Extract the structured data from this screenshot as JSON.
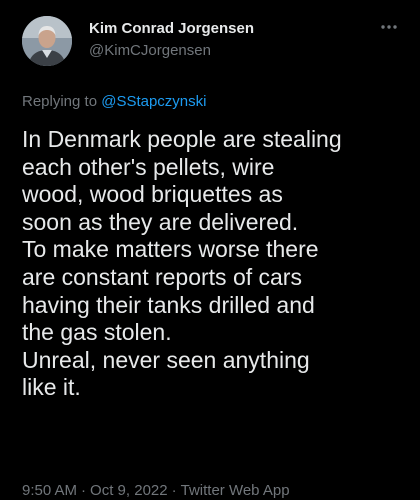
{
  "author": {
    "name": "Kim Conrad Jorgensen",
    "handle": "@KimCJorgensen"
  },
  "reply": {
    "prefix": "Replying to",
    "target": "@SStapczynski"
  },
  "tweet": {
    "lines": [
      "In Denmark people are stealing",
      "each other's pellets, wire",
      "wood, wood briquettes as",
      "soon as they are delivered.",
      "To make matters worse there",
      "are constant reports of cars",
      "having their tanks drilled and",
      "the gas stolen.",
      "Unreal, never seen anything",
      "like it."
    ]
  },
  "meta": {
    "time": "9:50 AM",
    "separator": "·",
    "date": "Oct 9, 2022",
    "source": "Twitter Web App"
  },
  "icons": {
    "more": "more-horizontal-icon"
  },
  "colors": {
    "background": "#000000",
    "text": "#e7e9ea",
    "muted": "#71767b",
    "link": "#1d9bf0"
  }
}
